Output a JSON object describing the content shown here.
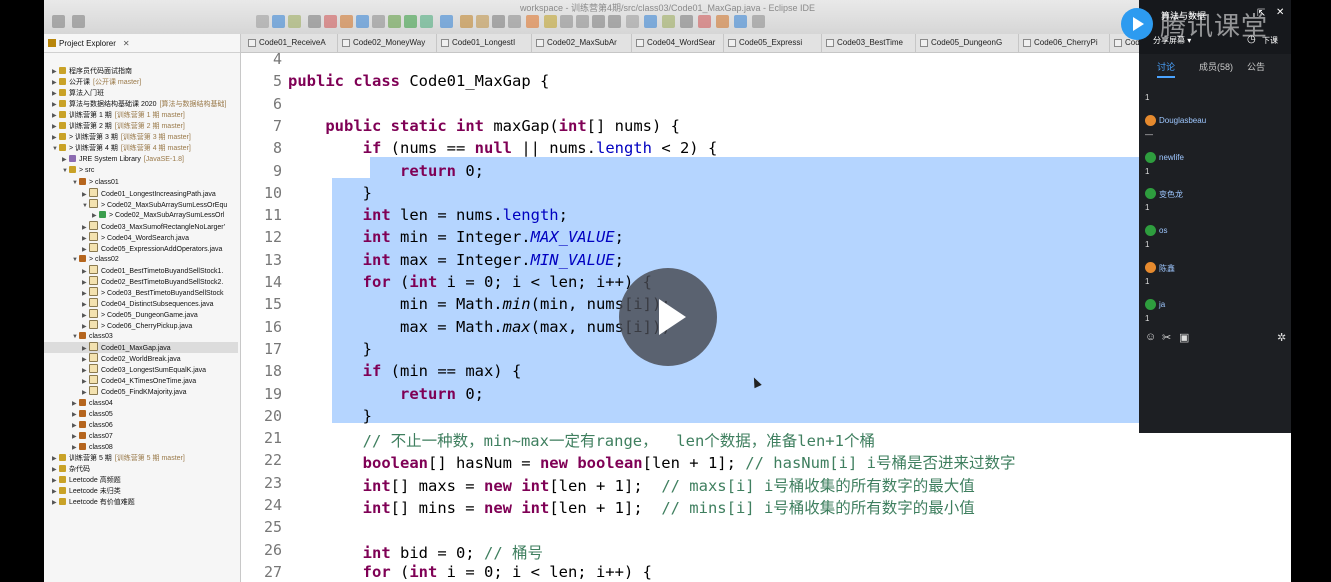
{
  "window_title": "workspace - 训练营第4期/src/class03/Code01_MaxGap.java - Eclipse IDE",
  "explorer": {
    "title": "Project Explorer",
    "items": [
      {
        "label": "程序员代码面试指南",
        "deco": "",
        "indent": 0,
        "arrow": "▶",
        "icon": "project"
      },
      {
        "label": "公开课",
        "deco": "[公开课 master]",
        "indent": 0,
        "arrow": "▶",
        "icon": "project"
      },
      {
        "label": "算法入门班",
        "deco": "",
        "indent": 0,
        "arrow": "▶",
        "icon": "project"
      },
      {
        "label": "算法与数据结构基础课 2020",
        "deco": "[算法与数据结构基础]",
        "indent": 0,
        "arrow": "▶",
        "icon": "project"
      },
      {
        "label": "训练营第 1 期",
        "deco": "[训练营第 1 期 master]",
        "indent": 0,
        "arrow": "▶",
        "icon": "project"
      },
      {
        "label": "训练营第 2 期",
        "deco": "[训练营第 2 期 master]",
        "indent": 0,
        "arrow": "▶",
        "icon": "project"
      },
      {
        "label": "> 训练营第 3 期",
        "deco": "[训练营第 3 期 master]",
        "indent": 0,
        "arrow": "▶",
        "icon": "project"
      },
      {
        "label": "> 训练营第 4 期",
        "deco": "[训练营第 4 期 master]",
        "indent": 0,
        "arrow": "▼",
        "icon": "project"
      },
      {
        "label": "JRE System Library",
        "deco": "[JavaSE-1.8]",
        "indent": 1,
        "arrow": "▶",
        "icon": "lib"
      },
      {
        "label": "> src",
        "deco": "",
        "indent": 1,
        "arrow": "▼",
        "icon": "src"
      },
      {
        "label": "> class01",
        "deco": "",
        "indent": 2,
        "arrow": "▼",
        "icon": "pkg"
      },
      {
        "label": "Code01_LongestIncreasingPath.java",
        "deco": "",
        "indent": 3,
        "arrow": "▶",
        "icon": "java"
      },
      {
        "label": "> Code02_MaxSubArraySumLessOrEqu",
        "deco": "",
        "indent": 3,
        "arrow": "▼",
        "icon": "java"
      },
      {
        "label": "> Code02_MaxSubArraySumLessOrl",
        "deco": "",
        "indent": 4,
        "arrow": "▶",
        "icon": "class"
      },
      {
        "label": "Code03_MaxSumofRectangleNoLarger'",
        "deco": "",
        "indent": 3,
        "arrow": "▶",
        "icon": "java"
      },
      {
        "label": "> Code04_WordSearch.java",
        "deco": "",
        "indent": 3,
        "arrow": "▶",
        "icon": "java"
      },
      {
        "label": "Code05_ExpressionAddOperators.java",
        "deco": "",
        "indent": 3,
        "arrow": "▶",
        "icon": "java"
      },
      {
        "label": "> class02",
        "deco": "",
        "indent": 2,
        "arrow": "▼",
        "icon": "pkg"
      },
      {
        "label": "Code01_BestTimetoBuyandSellStock1.",
        "deco": "",
        "indent": 3,
        "arrow": "▶",
        "icon": "java"
      },
      {
        "label": "Code02_BestTimetoBuyandSellStock2.",
        "deco": "",
        "indent": 3,
        "arrow": "▶",
        "icon": "java"
      },
      {
        "label": "> Code03_BestTimetoBuyandSellStock",
        "deco": "",
        "indent": 3,
        "arrow": "▶",
        "icon": "java"
      },
      {
        "label": "Code04_DistinctSubsequences.java",
        "deco": "",
        "indent": 3,
        "arrow": "▶",
        "icon": "java"
      },
      {
        "label": "> Code05_DungeonGame.java",
        "deco": "",
        "indent": 3,
        "arrow": "▶",
        "icon": "java"
      },
      {
        "label": "> Code06_CherryPickup.java",
        "deco": "",
        "indent": 3,
        "arrow": "▶",
        "icon": "java"
      },
      {
        "label": "class03",
        "deco": "",
        "indent": 2,
        "arrow": "▼",
        "icon": "pkg"
      },
      {
        "label": "Code01_MaxGap.java",
        "deco": "",
        "indent": 3,
        "arrow": "▶",
        "icon": "java",
        "selected": true
      },
      {
        "label": "Code02_WorldBreak.java",
        "deco": "",
        "indent": 3,
        "arrow": "▶",
        "icon": "java"
      },
      {
        "label": "Code03_LongestSumEqualK.java",
        "deco": "",
        "indent": 3,
        "arrow": "▶",
        "icon": "java"
      },
      {
        "label": "Code04_KTimesOneTime.java",
        "deco": "",
        "indent": 3,
        "arrow": "▶",
        "icon": "java"
      },
      {
        "label": "Code05_FindKMajority.java",
        "deco": "",
        "indent": 3,
        "arrow": "▶",
        "icon": "java"
      },
      {
        "label": "class04",
        "deco": "",
        "indent": 2,
        "arrow": "▶",
        "icon": "pkg"
      },
      {
        "label": "class05",
        "deco": "",
        "indent": 2,
        "arrow": "▶",
        "icon": "pkg"
      },
      {
        "label": "class06",
        "deco": "",
        "indent": 2,
        "arrow": "▶",
        "icon": "pkg"
      },
      {
        "label": "class07",
        "deco": "",
        "indent": 2,
        "arrow": "▶",
        "icon": "pkg"
      },
      {
        "label": "class08",
        "deco": "",
        "indent": 2,
        "arrow": "▶",
        "icon": "pkg"
      },
      {
        "label": "训练营第 5 期",
        "deco": "[训练营第 5 期 master]",
        "indent": 0,
        "arrow": "▶",
        "icon": "project"
      },
      {
        "label": "杂代码",
        "deco": "",
        "indent": 0,
        "arrow": "▶",
        "icon": "project"
      },
      {
        "label": "Leetcode 高频题",
        "deco": "",
        "indent": 0,
        "arrow": "▶",
        "icon": "project"
      },
      {
        "label": "Leetcode 未归类",
        "deco": "",
        "indent": 0,
        "arrow": "▶",
        "icon": "project"
      },
      {
        "label": "Leetcode 有价值难题",
        "deco": "",
        "indent": 0,
        "arrow": "▶",
        "icon": "project"
      }
    ]
  },
  "tabs": [
    "Code01_ReceiveA",
    "Code02_MoneyWay",
    "Code01_LongestI",
    "Code02_MaxSubAr",
    "Code04_WordSear",
    "Code05_Expressi",
    "Code03_BestTime",
    "Code05_DungeonG",
    "Code06_CherryPi",
    "Code0"
  ],
  "editor": {
    "lines": [
      {
        "n": "4",
        "tokens": []
      },
      {
        "n": "5",
        "tokens": [
          [
            "kw",
            "public"
          ],
          [
            "t",
            " "
          ],
          [
            "kw",
            "class"
          ],
          [
            "t",
            " Code01_MaxGap {"
          ]
        ]
      },
      {
        "n": "6",
        "tokens": []
      },
      {
        "n": "7",
        "tokens": [
          [
            "t",
            "    "
          ],
          [
            "kw",
            "public"
          ],
          [
            "t",
            " "
          ],
          [
            "kw",
            "static"
          ],
          [
            "t",
            " "
          ],
          [
            "kw",
            "int"
          ],
          [
            "t",
            " maxGap("
          ],
          [
            "kw",
            "int"
          ],
          [
            "t",
            "[] nums) {"
          ]
        ]
      },
      {
        "n": "8",
        "tokens": [
          [
            "t",
            "        "
          ],
          [
            "kw",
            "if"
          ],
          [
            "t",
            " (nums == "
          ],
          [
            "kw",
            "null"
          ],
          [
            "t",
            " || nums."
          ],
          [
            "fld",
            "length"
          ],
          [
            "t",
            " < 2) {"
          ]
        ]
      },
      {
        "n": "9",
        "tokens": [
          [
            "t",
            "            "
          ],
          [
            "kw",
            "return"
          ],
          [
            "t",
            " 0;"
          ]
        ]
      },
      {
        "n": "10",
        "tokens": [
          [
            "t",
            "        }"
          ]
        ]
      },
      {
        "n": "11",
        "tokens": [
          [
            "t",
            "        "
          ],
          [
            "kw",
            "int"
          ],
          [
            "t",
            " len = nums."
          ],
          [
            "fld",
            "length"
          ],
          [
            "t",
            ";"
          ]
        ]
      },
      {
        "n": "12",
        "tokens": [
          [
            "t",
            "        "
          ],
          [
            "kw",
            "int"
          ],
          [
            "t",
            " min = Integer."
          ],
          [
            "sf",
            "MAX_VALUE"
          ],
          [
            "t",
            ";"
          ]
        ]
      },
      {
        "n": "13",
        "tokens": [
          [
            "t",
            "        "
          ],
          [
            "kw",
            "int"
          ],
          [
            "t",
            " max = Integer."
          ],
          [
            "sf",
            "MIN_VALUE"
          ],
          [
            "t",
            ";"
          ]
        ]
      },
      {
        "n": "14",
        "tokens": [
          [
            "t",
            "        "
          ],
          [
            "kw",
            "for"
          ],
          [
            "t",
            " ("
          ],
          [
            "kw",
            "int"
          ],
          [
            "t",
            " i = 0; i < len; i++) {"
          ]
        ]
      },
      {
        "n": "15",
        "tokens": [
          [
            "t",
            "            min = Math."
          ],
          [
            "sm",
            "min"
          ],
          [
            "t",
            "(min, nums[i]);"
          ]
        ]
      },
      {
        "n": "16",
        "tokens": [
          [
            "t",
            "            max = Math."
          ],
          [
            "sm",
            "max"
          ],
          [
            "t",
            "(max, nums[i]);"
          ]
        ]
      },
      {
        "n": "17",
        "tokens": [
          [
            "t",
            "        }"
          ]
        ]
      },
      {
        "n": "18",
        "tokens": [
          [
            "t",
            "        "
          ],
          [
            "kw",
            "if"
          ],
          [
            "t",
            " (min == max) {"
          ]
        ]
      },
      {
        "n": "19",
        "tokens": [
          [
            "t",
            "            "
          ],
          [
            "kw",
            "return"
          ],
          [
            "t",
            " 0;"
          ]
        ]
      },
      {
        "n": "20",
        "tokens": [
          [
            "t",
            "        }"
          ]
        ]
      },
      {
        "n": "21",
        "tokens": [
          [
            "t",
            "        "
          ],
          [
            "cm",
            "// 不止一种数，min~max一定有range，  len个数据，准备len+1个桶"
          ]
        ]
      },
      {
        "n": "22",
        "tokens": [
          [
            "t",
            "        "
          ],
          [
            "kw",
            "boolean"
          ],
          [
            "t",
            "[] hasNum = "
          ],
          [
            "kw",
            "new"
          ],
          [
            "t",
            " "
          ],
          [
            "kw",
            "boolean"
          ],
          [
            "t",
            "[len + 1]; "
          ],
          [
            "cm",
            "// hasNum[i] i号桶是否进来过数字"
          ]
        ]
      },
      {
        "n": "23",
        "tokens": [
          [
            "t",
            "        "
          ],
          [
            "kw",
            "int"
          ],
          [
            "t",
            "[] maxs = "
          ],
          [
            "kw",
            "new"
          ],
          [
            "t",
            " "
          ],
          [
            "kw",
            "int"
          ],
          [
            "t",
            "[len + 1];  "
          ],
          [
            "cm",
            "// maxs[i] i号桶收集的所有数字的最大值"
          ]
        ]
      },
      {
        "n": "24",
        "tokens": [
          [
            "t",
            "        "
          ],
          [
            "kw",
            "int"
          ],
          [
            "t",
            "[] mins = "
          ],
          [
            "kw",
            "new"
          ],
          [
            "t",
            " "
          ],
          [
            "kw",
            "int"
          ],
          [
            "t",
            "[len + 1];  "
          ],
          [
            "cm",
            "// mins[i] i号桶收集的所有数字的最小值"
          ]
        ]
      },
      {
        "n": "25",
        "tokens": []
      },
      {
        "n": "26",
        "tokens": [
          [
            "t",
            "        "
          ],
          [
            "kw",
            "int"
          ],
          [
            "t",
            " bid = 0; "
          ],
          [
            "cm",
            "// 桶号"
          ]
        ]
      },
      {
        "n": "27",
        "tokens": [
          [
            "t",
            "        "
          ],
          [
            "kw",
            "for"
          ],
          [
            "t",
            " ("
          ],
          [
            "kw",
            "int"
          ],
          [
            "t",
            " i = 0; i < len; i++) {"
          ]
        ]
      }
    ]
  },
  "panel": {
    "course_title": "算法与数据",
    "brand": "腾讯课堂",
    "share_label": "分享屏幕 ▾",
    "end_label": "下课",
    "tabs": [
      "讨论",
      "成员(58)",
      "公告"
    ],
    "messages": [
      {
        "name": "",
        "body": "1",
        "color": "#2e9d3e"
      },
      {
        "name": "Douglasbeau",
        "body": "—",
        "color": "#e68a2e"
      },
      {
        "name": "newlife",
        "body": "1",
        "color": "#2e9d3e"
      },
      {
        "name": "变色龙",
        "body": "1",
        "color": "#2e9d3e"
      },
      {
        "name": "os",
        "body": "1",
        "color": "#2e9d3e"
      },
      {
        "name": "陈鑫",
        "body": "1",
        "color": "#e68a2e"
      },
      {
        "name": "ja",
        "body": "1",
        "color": "#2e9d3e"
      }
    ]
  },
  "colors": {
    "keyword": "#7f0055",
    "comment": "#3f7f5f",
    "field": "#0000c0",
    "selection": "#b5d5ff"
  }
}
